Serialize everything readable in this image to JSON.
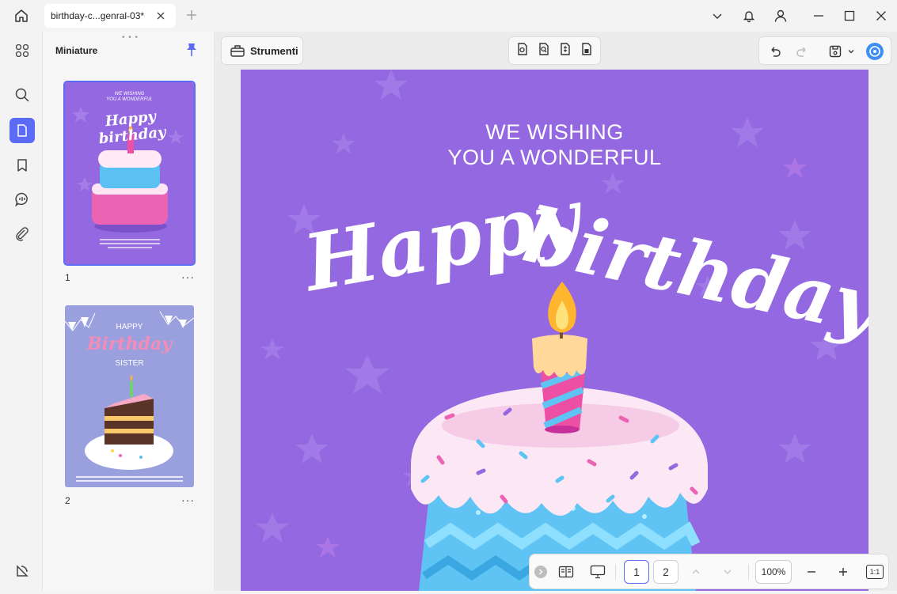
{
  "tab": {
    "title": "birthday-c...genral-03*"
  },
  "thumbnails": {
    "title": "Miniature",
    "pages": [
      {
        "number": "1",
        "more": "···",
        "text_top": "WE WISHING",
        "text_top2": "YOU A WONDERFUL",
        "script": "Happy birthday"
      },
      {
        "number": "2",
        "more": "···",
        "text_top": "HAPPY",
        "script": "Birthday",
        "text_bottom": "SISTER"
      }
    ]
  },
  "toolbar": {
    "tools_label": "Strumenti"
  },
  "document": {
    "line1": "WE WISHING",
    "line2": "YOU A WONDERFUL",
    "script_word1": "Happy",
    "script_word2": "birthday"
  },
  "bottombar": {
    "page1": "1",
    "page2": "2",
    "zoom": "100%",
    "fit": "1:1"
  },
  "colors": {
    "accent": "#5b6bf5",
    "page_bg": "#9468e0"
  }
}
